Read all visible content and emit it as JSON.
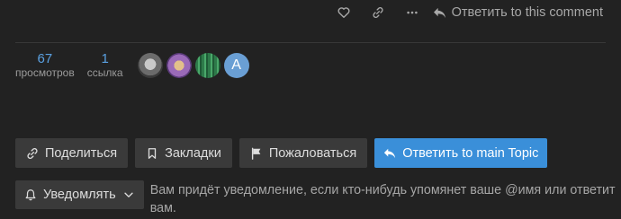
{
  "post_actions": {
    "like_icon": "heart-icon",
    "link_icon": "link-icon",
    "more_icon": "ellipsis-icon",
    "reply_label": "Ответить to this comment"
  },
  "topic_map": {
    "views": {
      "count": "67",
      "label": "просмотров"
    },
    "links": {
      "count": "1",
      "label": "ссылка"
    },
    "avatars": [
      {
        "kind": "image"
      },
      {
        "kind": "image"
      },
      {
        "kind": "image"
      },
      {
        "kind": "letter",
        "letter": "A",
        "color": "#6a9fd4"
      }
    ]
  },
  "footer": {
    "share_label": "Поделиться",
    "bookmark_label": "Закладки",
    "flag_label": "Пожаловаться",
    "reply_label": "Ответить to main Topic"
  },
  "notifications": {
    "button_label": "Уведомлять",
    "description": "Вам придёт уведомление, если кто-нибудь упомянет ваше @имя или ответит вам."
  },
  "colors": {
    "background": "#222222",
    "button": "#3a3a3a",
    "primary": "#3a8fd9",
    "stat_number": "#5aa0e0"
  }
}
